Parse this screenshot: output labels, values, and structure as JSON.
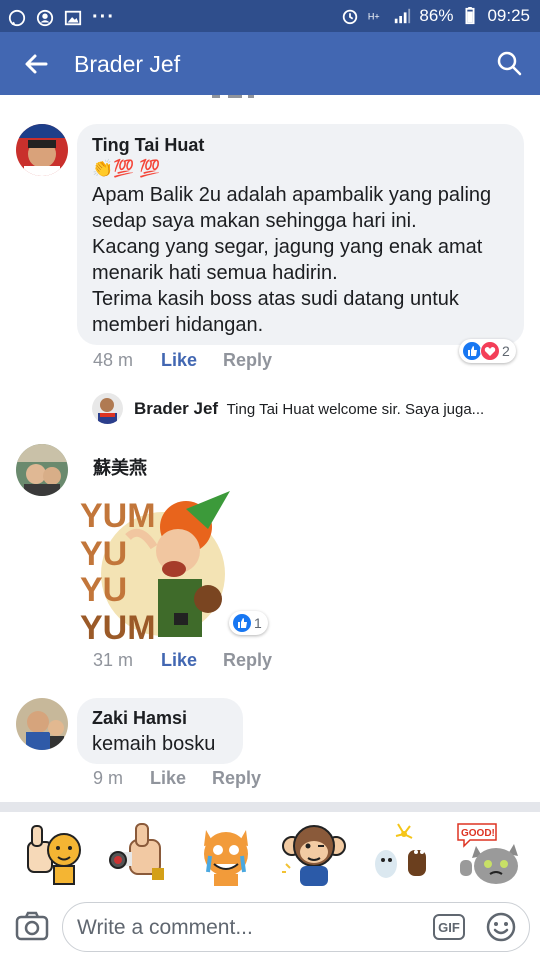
{
  "status_bar": {
    "battery": "86%",
    "time": "09:25",
    "dots": "···"
  },
  "app_bar": {
    "title": "Brader Jef"
  },
  "comments": [
    {
      "author": "Ting Tai Huat",
      "emoji_line": "👏💯 💯",
      "text_lines": [
        "Apam Balik 2u adalah apambalik yang paling",
        "sedap saya makan sehingga hari ini.",
        "Kacang yang segar, jagung yang enak amat",
        "menarik hati semua hadirin.",
        "Terima kasih boss atas sudi datang untuk",
        "memberi hidangan."
      ],
      "time": "48 m",
      "like_label": "Like",
      "reply_label": "Reply",
      "reaction_count": "2",
      "reply_preview": {
        "author": "Brader Jef",
        "text": "Ting Tai Huat welcome sir. Saya juga..."
      }
    },
    {
      "author": "蘇美燕",
      "sticker_text": "YUM YUM YUM YUM",
      "time": "31 m",
      "like_label": "Like",
      "reply_label": "Reply",
      "reaction_count": "1"
    },
    {
      "author": "Zaki Hamsi",
      "text": "kemaih bosku",
      "time": "9 m",
      "like_label": "Like",
      "reply_label": "Reply"
    }
  ],
  "sticker_tray": {
    "labels": [
      "GOOD!"
    ]
  },
  "composer": {
    "placeholder": "Write a comment...",
    "gif_label": "GIF"
  },
  "colors": {
    "status_bar": "#2f4e8c",
    "app_bar": "#4267b2",
    "like_blue": "#4267b2",
    "bubble": "#f0f2f5"
  }
}
